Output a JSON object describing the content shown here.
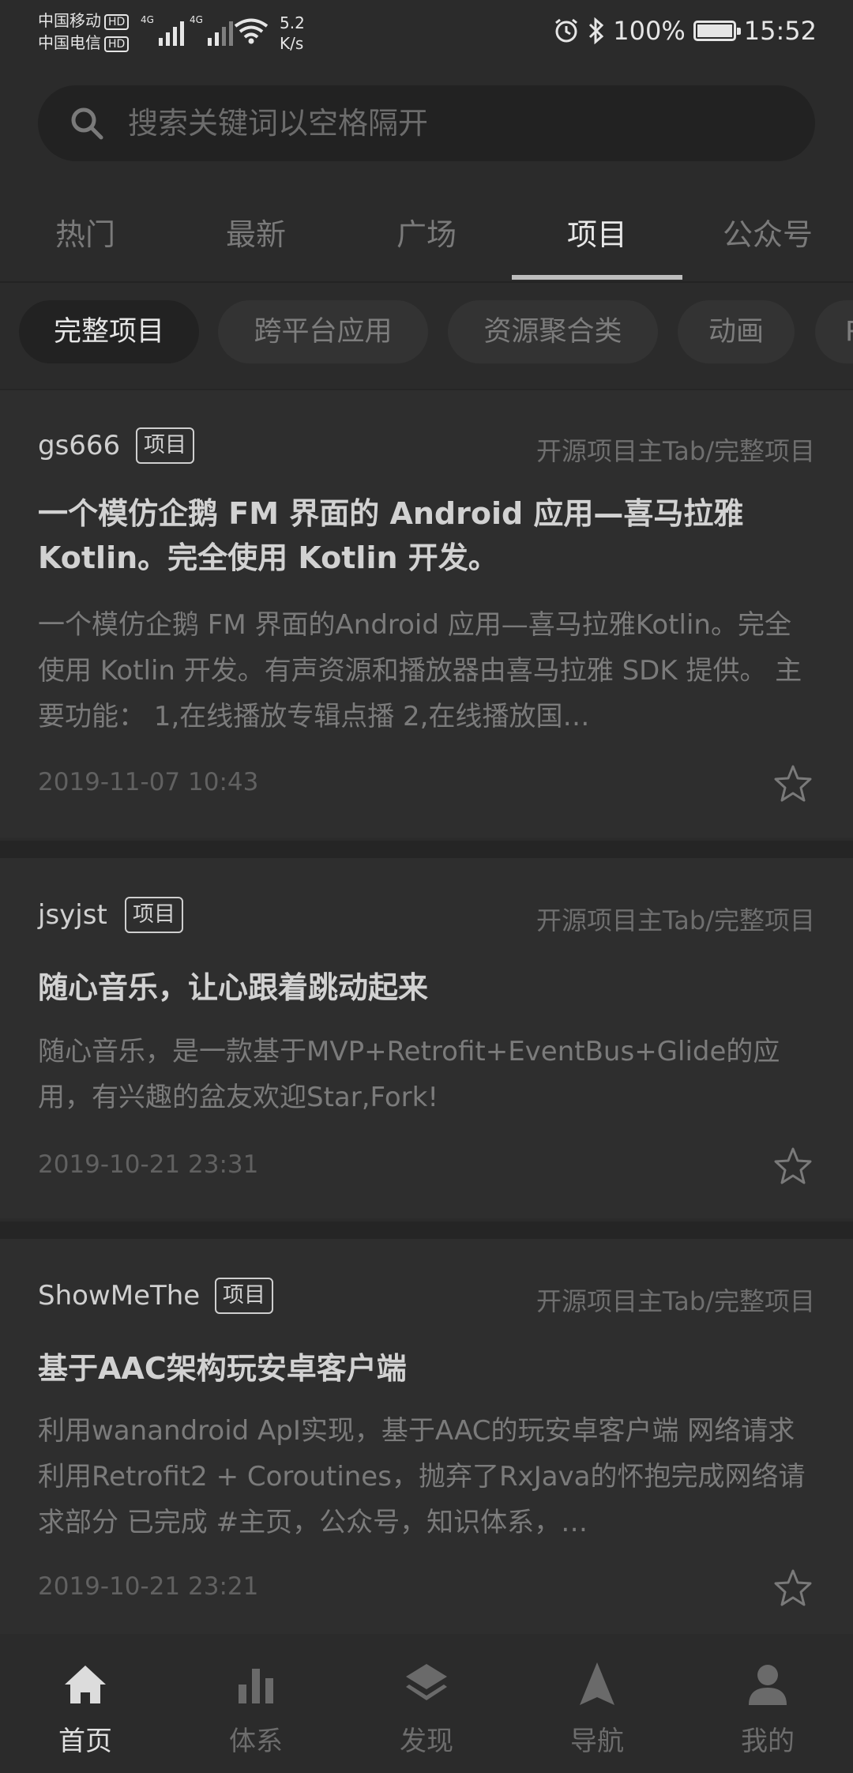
{
  "status_bar": {
    "carrier1": "中国移动",
    "carrier2": "中国电信",
    "hd": "HD",
    "net": "4G",
    "speed_value": "5.2",
    "speed_unit": "K/s",
    "battery": "100%",
    "time": "15:52",
    "battery_level": 1.0
  },
  "search": {
    "placeholder": "搜索关键词以空格隔开"
  },
  "tabs": [
    {
      "label": "热门"
    },
    {
      "label": "最新"
    },
    {
      "label": "广场"
    },
    {
      "label": "项目"
    },
    {
      "label": "公众号"
    }
  ],
  "chips": [
    {
      "label": "完整项目"
    },
    {
      "label": "跨平台应用"
    },
    {
      "label": "资源聚合类"
    },
    {
      "label": "动画"
    },
    {
      "label": "R"
    }
  ],
  "articles": [
    {
      "author": "gs666",
      "tag": "项目",
      "category": "开源项目主Tab/完整项目",
      "title": "一个模仿企鹅 FM 界面的 Android 应用—喜马拉雅 Kotlin。完全使用 Kotlin 开发。",
      "desc": "一个模仿企鹅 FM 界面的Android 应用—喜马拉雅Kotlin。完全使用 Kotlin 开发。有声资源和播放器由喜马拉雅 SDK 提供。 主要功能： 1,在线播放专辑点播 2,在线播放国…",
      "date": "2019-11-07 10:43"
    },
    {
      "author": "jsyjst",
      "tag": "项目",
      "category": "开源项目主Tab/完整项目",
      "title": "随心音乐，让心跟着跳动起来",
      "desc": "随心音乐，是一款基于MVP+Retrofit+EventBus+Glide的应用，有兴趣的盆友欢迎Star,Fork!",
      "date": "2019-10-21 23:31"
    },
    {
      "author": "ShowMeThe",
      "tag": "项目",
      "category": "开源项目主Tab/完整项目",
      "title": "基于AAC架构玩安卓客户端",
      "desc": "利用wanandroid ApI实现，基于AAC的玩安卓客户端 网络请求利用Retrofit2 + Coroutines，抛弃了RxJava的怀抱完成网络请求部分 已完成 #主页，公众号，知识体系，…",
      "date": "2019-10-21 23:21"
    }
  ],
  "bottom_nav": [
    {
      "label": "首页",
      "icon": "home-icon"
    },
    {
      "label": "体系",
      "icon": "bar-chart-icon"
    },
    {
      "label": "发现",
      "icon": "layers-icon"
    },
    {
      "label": "导航",
      "icon": "navigation-icon"
    },
    {
      "label": "我的",
      "icon": "person-icon"
    }
  ]
}
